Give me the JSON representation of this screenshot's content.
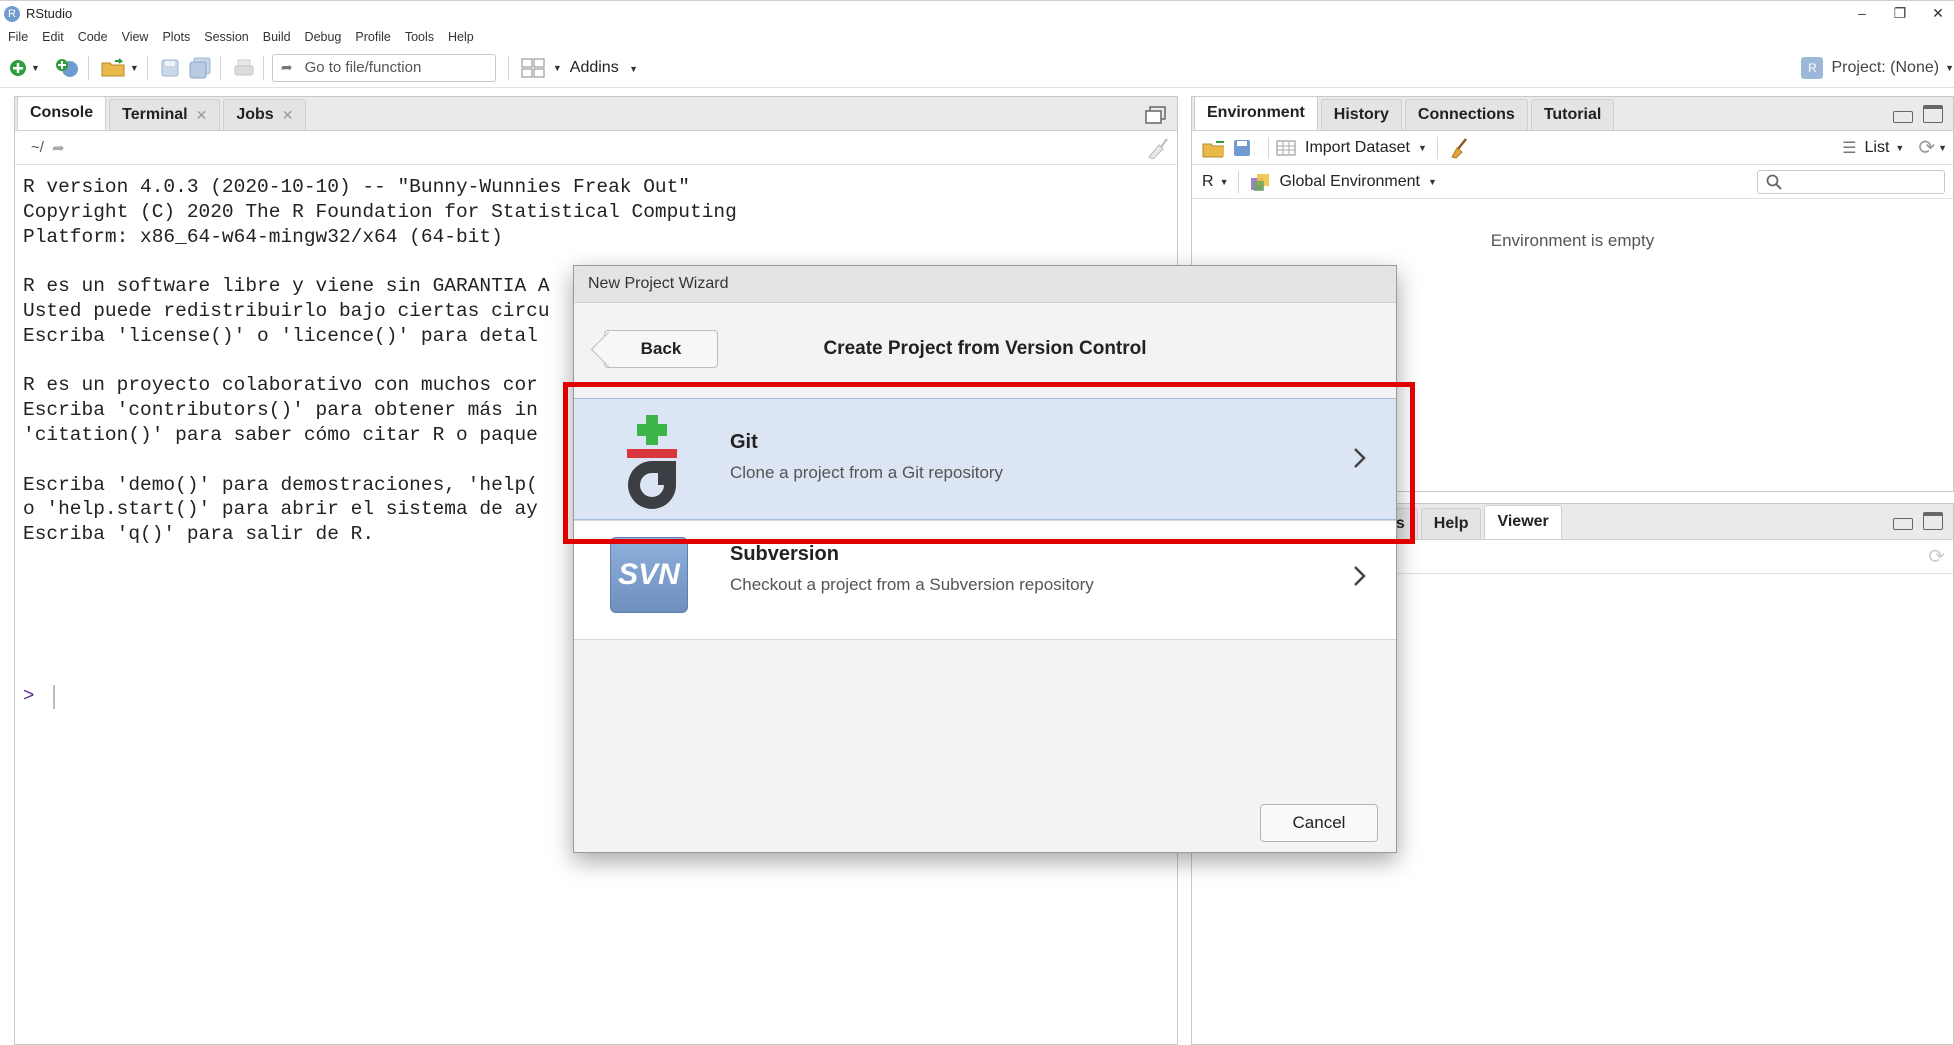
{
  "window": {
    "title": "RStudio",
    "app_icon": "R",
    "controls": [
      "–",
      "❐",
      "✕"
    ]
  },
  "menu": [
    "File",
    "Edit",
    "Code",
    "View",
    "Plots",
    "Session",
    "Build",
    "Debug",
    "Profile",
    "Tools",
    "Help"
  ],
  "toolbar": {
    "goto_placeholder": "Go to file/function",
    "addins_label": "Addins",
    "project_label": "Project: (None)",
    "project_icon": "R"
  },
  "left_pane": {
    "tabs": [
      {
        "label": "Console",
        "closable": false,
        "active": true
      },
      {
        "label": "Terminal",
        "closable": true,
        "active": false
      },
      {
        "label": "Jobs",
        "closable": true,
        "active": false
      }
    ],
    "path": "~/",
    "console_lines": [
      "R version 4.0.3 (2020-10-10) -- \"Bunny-Wunnies Freak Out\"",
      "Copyright (C) 2020 The R Foundation for Statistical Computing",
      "Platform: x86_64-w64-mingw32/x64 (64-bit)",
      "",
      "R es un software libre y viene sin GARANTIA A",
      "Usted puede redistribuirlo bajo ciertas circu",
      "Escriba 'license()' o 'licence()' para detal",
      "",
      "R es un proyecto colaborativo con muchos cor",
      "Escriba 'contributors()' para obtener más in",
      "'citation()' para saber cómo citar R o paque",
      "",
      "Escriba 'demo()' para demostraciones, 'help(",
      "o 'help.start()' para abrir el sistema de ay",
      "Escriba 'q()' para salir de R."
    ],
    "prompt": ">"
  },
  "right_top_pane": {
    "tabs": [
      {
        "label": "Environment",
        "active": true
      },
      {
        "label": "History",
        "active": false
      },
      {
        "label": "Connections",
        "active": false
      },
      {
        "label": "Tutorial",
        "active": false
      }
    ],
    "import_dataset_label": "Import Dataset",
    "list_label": "List",
    "language_label": "R",
    "scope_label": "Global Environment",
    "empty_message": "Environment is empty"
  },
  "right_bottom_pane": {
    "tabs": [
      {
        "label": "es",
        "active": false
      },
      {
        "label": "Help",
        "active": false
      },
      {
        "label": "Viewer",
        "active": true
      }
    ]
  },
  "dialog": {
    "header": "New Project Wizard",
    "back_label": "Back",
    "title": "Create Project from Version Control",
    "options": [
      {
        "title": "Git",
        "description": "Clone a project from a Git repository",
        "icon": "git-icon",
        "selected": true
      },
      {
        "title": "Subversion",
        "description": "Checkout a project from a Subversion repository",
        "icon": "svn-icon",
        "icon_text": "SVN",
        "selected": false
      }
    ],
    "cancel_label": "Cancel"
  },
  "annotation": {
    "color": "#e00000"
  }
}
